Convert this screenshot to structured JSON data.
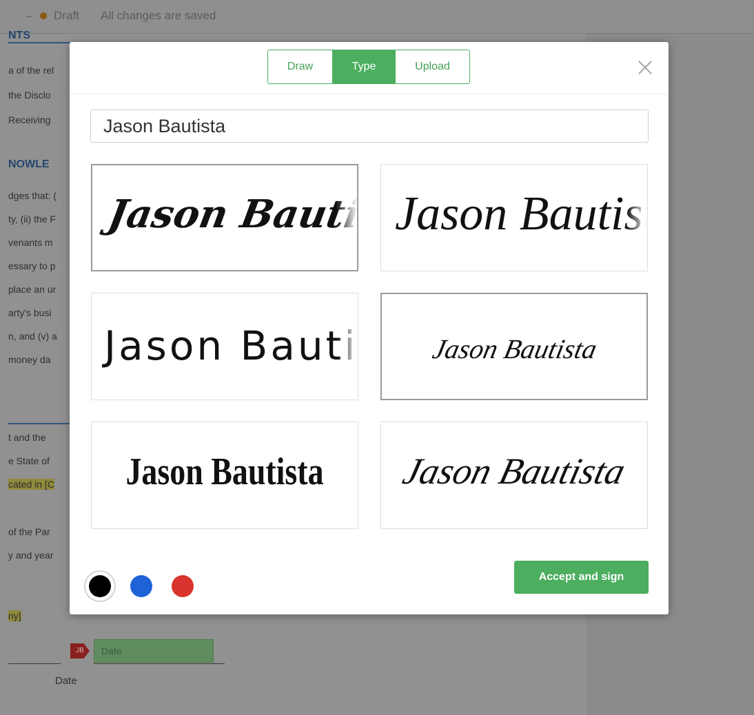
{
  "status_bar": {
    "dash": "–",
    "draft_label": "Draft",
    "saved_text": "All changes are saved"
  },
  "document": {
    "heading_top": "NTS",
    "lines_1": [
      "a of the rel",
      "the Disclo",
      "Receiving"
    ],
    "heading_ack": "NOWLE",
    "lines_2": [
      "dges that: (",
      "ty, (ii) the F",
      "venants m",
      "essary to p",
      "place an ur",
      "arty's busi",
      "n, and (v) a",
      "money da"
    ],
    "lines_3": [
      "t and the",
      "e State of",
      "cated in [C"
    ],
    "lines_4": [
      "of the Par",
      "y and year"
    ],
    "line_5": "ny]",
    "date_tag": "JB",
    "date_placeholder": "Date",
    "date_label": "Date"
  },
  "modal": {
    "tabs": [
      {
        "label": "Draw",
        "active": false
      },
      {
        "label": "Type",
        "active": true
      },
      {
        "label": "Upload",
        "active": false
      }
    ],
    "name_value": "Jason Bautista",
    "signatures": [
      {
        "style": "brush-italic",
        "text": "Jason Bautista",
        "selected": true
      },
      {
        "style": "flourish-script",
        "text": "Jason Bautista",
        "selected": false
      },
      {
        "style": "marker-print",
        "text": "Jason Bautista",
        "selected": false
      },
      {
        "style": "small-script",
        "text": "Jason Bautista",
        "selected": true
      },
      {
        "style": "bold-condensed",
        "text": "Jason Bautista",
        "selected": false
      },
      {
        "style": "elegant-script",
        "text": "Jason Bautista",
        "selected": false
      }
    ],
    "colors": [
      {
        "name": "black",
        "hex": "#000000",
        "selected": true
      },
      {
        "name": "blue",
        "hex": "#1f62d8",
        "selected": false
      },
      {
        "name": "red",
        "hex": "#d8332c",
        "selected": false
      }
    ],
    "accent_color": "#4cae5f",
    "accept_label": "Accept and sign",
    "close_icon": "close-icon"
  }
}
